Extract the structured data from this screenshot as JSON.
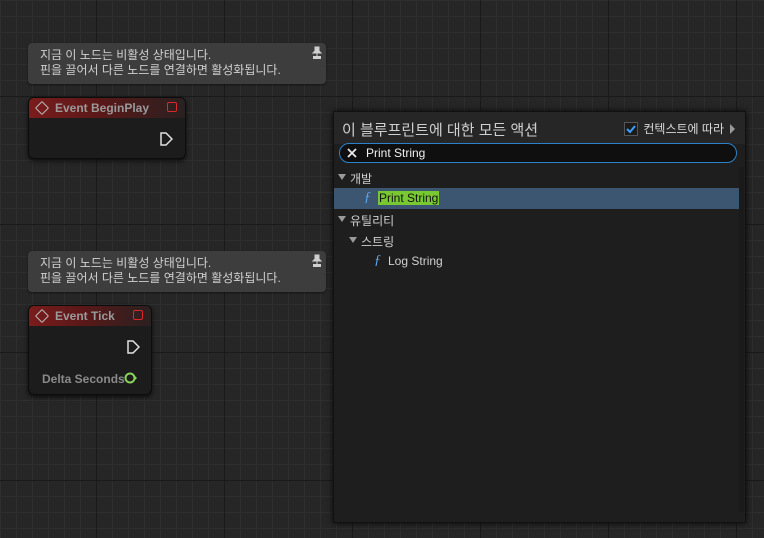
{
  "comments": [
    {
      "line1": "지금 이 노드는 비활성 상태입니다.",
      "line2": "핀을 끌어서 다른 노드를 연결하면 활성화됩니다."
    },
    {
      "line1": "지금 이 노드는 비활성 상태입니다.",
      "line2": "핀을 끌어서 다른 노드를 연결하면 활성화됩니다."
    }
  ],
  "nodes": {
    "begin_play": {
      "title": "Event BeginPlay"
    },
    "tick": {
      "title": "Event Tick",
      "pin_label": "Delta Seconds"
    }
  },
  "action_panel": {
    "title": "이 블루프린트에 대한 모든 액션",
    "context_label": "컨텍스트에 따라",
    "context_checked": true,
    "search_value": "Print String",
    "categories": [
      {
        "label": "개발",
        "items": [
          {
            "label": "Print String",
            "selected": true
          }
        ]
      },
      {
        "label": "유틸리티",
        "subcategories": [
          {
            "label": "스트링",
            "items": [
              {
                "label": "Log String"
              }
            ]
          }
        ]
      }
    ]
  },
  "colors": {
    "accent": "#2c82c8",
    "highlight": "#78c832",
    "selection": "#3c5570",
    "event_header": "#7a1c1c"
  }
}
